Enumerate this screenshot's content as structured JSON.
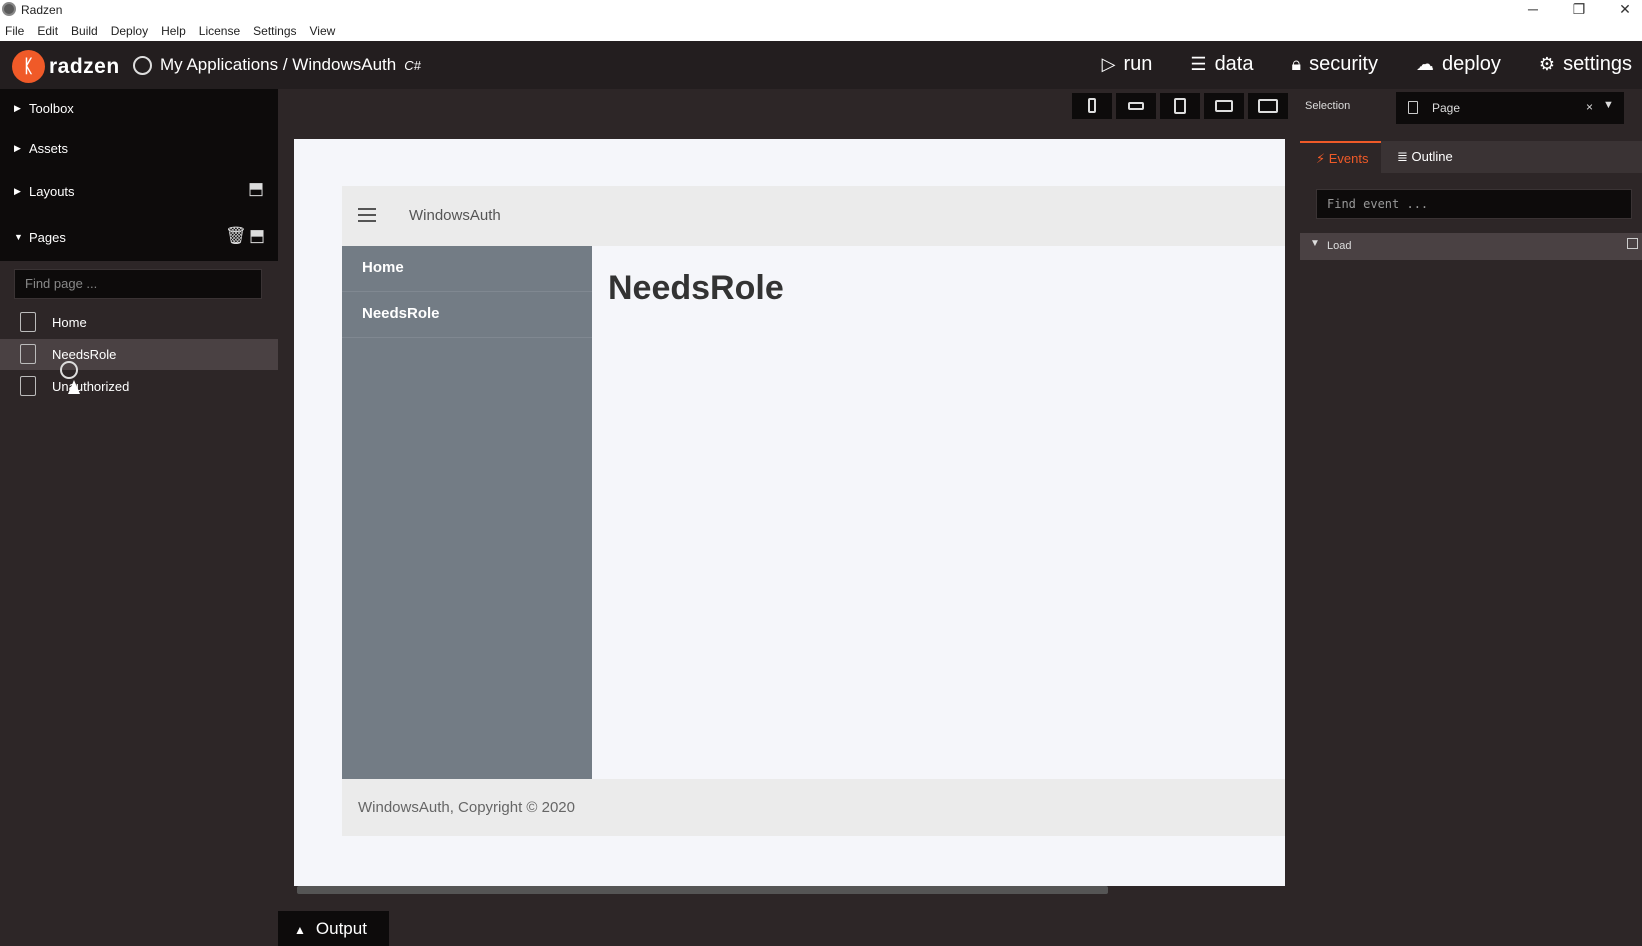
{
  "window": {
    "title": "Radzen",
    "controls": {
      "minimize": "─",
      "restore": "❐",
      "close": "✕"
    }
  },
  "menubar": [
    "File",
    "Edit",
    "Build",
    "Deploy",
    "Help",
    "License",
    "Settings",
    "View"
  ],
  "header": {
    "logo_text": "radzen",
    "breadcrumb": "My Applications / WindowsAuth",
    "language_badge": "C#",
    "nav": [
      {
        "label": "run",
        "icon": "play-icon"
      },
      {
        "label": "data",
        "icon": "layers-icon"
      },
      {
        "label": "security",
        "icon": "lock-icon"
      },
      {
        "label": "deploy",
        "icon": "cloud-upload-icon"
      },
      {
        "label": "settings",
        "icon": "gear-icon"
      }
    ]
  },
  "sidebar": {
    "sections": [
      "Toolbox",
      "Assets",
      "Layouts",
      "Pages"
    ],
    "find_page_placeholder": "Find page ...",
    "pages": [
      "Home",
      "NeedsRole",
      "Unauthorized"
    ],
    "selected_page": "NeedsRole"
  },
  "canvas": {
    "app_name": "WindowsAuth",
    "nav_items": [
      "Home",
      "NeedsRole"
    ],
    "page_heading": "NeedsRole",
    "footer": "WindowsAuth, Copyright © 2020"
  },
  "output": {
    "label": "Output"
  },
  "properties": {
    "selection_label": "Selection",
    "selection_value": "Page",
    "tabs": [
      "Events",
      "Outline"
    ],
    "active_tab": "Events",
    "find_event_placeholder": "Find event ...",
    "events": [
      "Load"
    ]
  },
  "colors": {
    "accent": "#f05a28",
    "background": "#2d2627",
    "panel": "#0d0b0b"
  }
}
